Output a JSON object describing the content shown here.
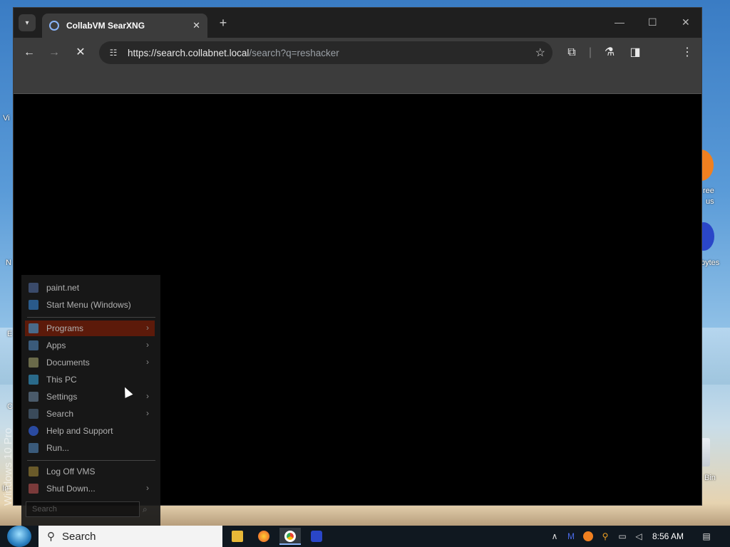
{
  "desktop": {
    "labels": [
      "Vi",
      "ree",
      "us",
      "N",
      "bytes",
      "E",
      "C",
      "In",
      "Bin"
    ]
  },
  "browser": {
    "tab": {
      "title": "CollabVM SearXNG"
    },
    "omnibox": {
      "url_host": "https://search.collabnet.local",
      "url_path": "/search?q=reshacker"
    },
    "window_controls": {
      "minimize": "—",
      "maximize": "☐",
      "close": "✕"
    },
    "new_tab": "+"
  },
  "start_menu": {
    "pinned": [
      {
        "label": "paint.net",
        "icon": "paintnet-icon"
      },
      {
        "label": "Start Menu (Windows)",
        "icon": "start-menu-icon"
      }
    ],
    "main": [
      {
        "label": "Programs",
        "icon": "programs-icon",
        "submenu": true,
        "active": true
      },
      {
        "label": "Apps",
        "icon": "apps-icon",
        "submenu": true
      },
      {
        "label": "Documents",
        "icon": "documents-icon",
        "submenu": true
      },
      {
        "label": "This PC",
        "icon": "this-pc-icon",
        "submenu": false
      },
      {
        "label": "Settings",
        "icon": "settings-icon",
        "submenu": true
      },
      {
        "label": "Search",
        "icon": "search-icon",
        "submenu": true
      },
      {
        "label": "Help and Support",
        "icon": "help-icon",
        "submenu": false
      },
      {
        "label": "Run...",
        "icon": "run-icon",
        "submenu": false
      }
    ],
    "power": [
      {
        "label": "Log Off VMS",
        "icon": "log-off-icon",
        "submenu": false
      },
      {
        "label": "Shut Down...",
        "icon": "shut-down-icon",
        "submenu": true
      }
    ],
    "search_placeholder": "Search",
    "edition_label": "Windows 10 Pro"
  },
  "taskbar": {
    "search_label": "Search",
    "clock": "8:56 AM"
  },
  "colors": {
    "browser_chrome": "#3c3c3c",
    "menu_active": "#5c1a0a",
    "taskbar": "#101820"
  }
}
